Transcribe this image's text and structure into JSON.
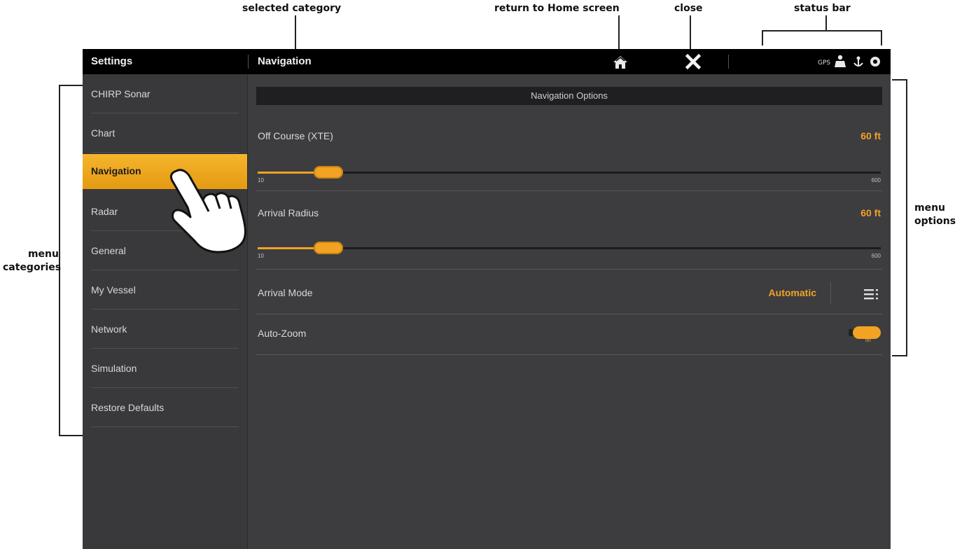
{
  "callouts": {
    "selected_category": "selected category",
    "return_home": "return to Home screen",
    "close": "close",
    "status_bar": "status bar",
    "menu_options": "menu\noptions",
    "menu_categories": "menu\ncategories"
  },
  "topbar": {
    "title": "Settings",
    "selected_category": "Navigation",
    "home_icon": "home-icon",
    "close_icon": "close-icon",
    "status_icons": [
      "gps-icon",
      "person-icon",
      "anchor-icon",
      "settings-icon"
    ]
  },
  "sidebar": {
    "items": [
      {
        "label": "CHIRP Sonar"
      },
      {
        "label": "Chart"
      },
      {
        "label": "Navigation",
        "selected": true
      },
      {
        "label": "Radar"
      },
      {
        "label": "General"
      },
      {
        "label": "My Vessel"
      },
      {
        "label": "Network"
      },
      {
        "label": "Simulation"
      },
      {
        "label": "Restore Defaults"
      }
    ]
  },
  "main": {
    "section_title": "Navigation Options",
    "off_course": {
      "label": "Off Course (XTE)",
      "value": "60 ft",
      "slider_min": "10",
      "slider_max": "600",
      "slider_fraction": 0.09
    },
    "arrival_radius": {
      "label": "Arrival Radius",
      "value": "60 ft",
      "slider_min": "10",
      "slider_max": "600",
      "slider_fraction": 0.09
    },
    "arrival_mode": {
      "label": "Arrival Mode",
      "value": "Automatic"
    },
    "auto_zoom": {
      "label": "Auto-Zoom",
      "state": "on"
    }
  },
  "colors": {
    "accent": "#f2a323",
    "background": "#3b3b3d",
    "topbar": "#000000"
  }
}
